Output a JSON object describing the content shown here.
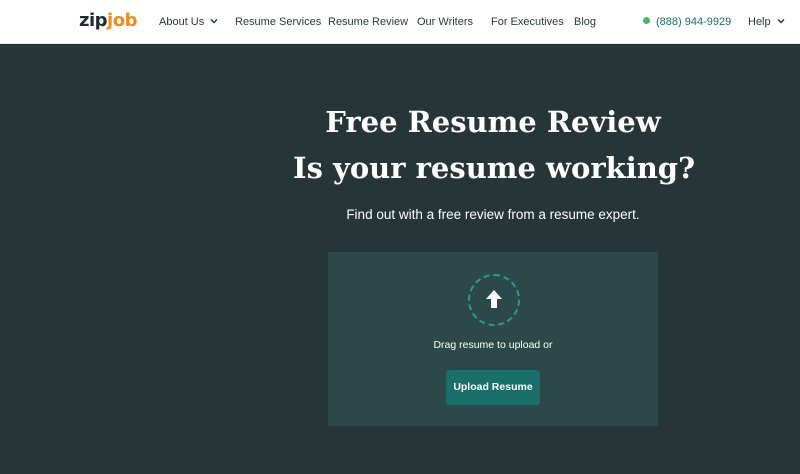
{
  "logo": {
    "part1": "zip",
    "part2": "job"
  },
  "nav": {
    "items": [
      {
        "label": "About Us"
      },
      {
        "label": "Resume Services"
      },
      {
        "label": "Resume Review"
      },
      {
        "label": "Our Writers"
      },
      {
        "label": "For Executives"
      },
      {
        "label": "Blog"
      }
    ],
    "phone": "(888) 944-9929",
    "help": "Help",
    "phone_status_color": "#4cb369"
  },
  "hero": {
    "title": "Free Resume Review",
    "subtitle": "Is your resume working?",
    "description": "Find out with a free review from a resume expert."
  },
  "upload": {
    "icon": "upload-arrow-icon",
    "drag_text": "Drag resume to upload or",
    "button_label": "Upload Resume",
    "button_color": "#1b6f6b"
  },
  "colors": {
    "background": "#263538",
    "upload_panel": "#2c4848",
    "logo_accent": "#ef8a1f"
  }
}
